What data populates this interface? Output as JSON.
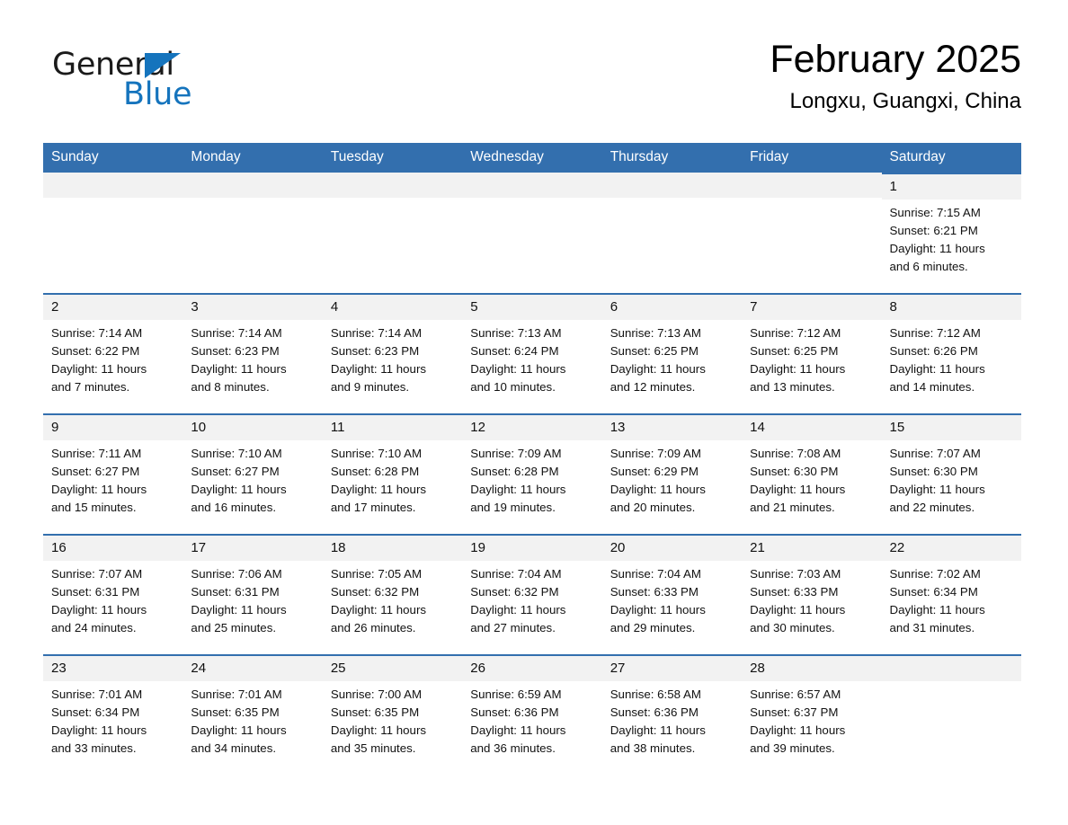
{
  "brand": {
    "word_one": "General",
    "word_two": "Blue",
    "triangle_icon": "triangle-icon",
    "accent_color": "#1574bd"
  },
  "header": {
    "month_title": "February 2025",
    "location": "Longxu, Guangxi, China",
    "header_bg_color": "#336fae",
    "daynum_bg_color": "#f2f2f2"
  },
  "weekday_headers": [
    "Sunday",
    "Monday",
    "Tuesday",
    "Wednesday",
    "Thursday",
    "Friday",
    "Saturday"
  ],
  "labels": {
    "sunrise_prefix": "Sunrise:",
    "sunset_prefix": "Sunset:",
    "daylight_prefix": "Daylight:"
  },
  "weeks": [
    [
      {
        "day": "",
        "sunrise": "",
        "sunset": "",
        "daylight_line1": "",
        "daylight_line2": "",
        "empty": true
      },
      {
        "day": "",
        "sunrise": "",
        "sunset": "",
        "daylight_line1": "",
        "daylight_line2": "",
        "empty": true
      },
      {
        "day": "",
        "sunrise": "",
        "sunset": "",
        "daylight_line1": "",
        "daylight_line2": "",
        "empty": true
      },
      {
        "day": "",
        "sunrise": "",
        "sunset": "",
        "daylight_line1": "",
        "daylight_line2": "",
        "empty": true
      },
      {
        "day": "",
        "sunrise": "",
        "sunset": "",
        "daylight_line1": "",
        "daylight_line2": "",
        "empty": true
      },
      {
        "day": "",
        "sunrise": "",
        "sunset": "",
        "daylight_line1": "",
        "daylight_line2": "",
        "empty": true
      },
      {
        "day": "1",
        "sunrise": "Sunrise: 7:15 AM",
        "sunset": "Sunset: 6:21 PM",
        "daylight_line1": "Daylight: 11 hours",
        "daylight_line2": "and 6 minutes.",
        "empty": false
      }
    ],
    [
      {
        "day": "2",
        "sunrise": "Sunrise: 7:14 AM",
        "sunset": "Sunset: 6:22 PM",
        "daylight_line1": "Daylight: 11 hours",
        "daylight_line2": "and 7 minutes.",
        "empty": false
      },
      {
        "day": "3",
        "sunrise": "Sunrise: 7:14 AM",
        "sunset": "Sunset: 6:23 PM",
        "daylight_line1": "Daylight: 11 hours",
        "daylight_line2": "and 8 minutes.",
        "empty": false
      },
      {
        "day": "4",
        "sunrise": "Sunrise: 7:14 AM",
        "sunset": "Sunset: 6:23 PM",
        "daylight_line1": "Daylight: 11 hours",
        "daylight_line2": "and 9 minutes.",
        "empty": false
      },
      {
        "day": "5",
        "sunrise": "Sunrise: 7:13 AM",
        "sunset": "Sunset: 6:24 PM",
        "daylight_line1": "Daylight: 11 hours",
        "daylight_line2": "and 10 minutes.",
        "empty": false
      },
      {
        "day": "6",
        "sunrise": "Sunrise: 7:13 AM",
        "sunset": "Sunset: 6:25 PM",
        "daylight_line1": "Daylight: 11 hours",
        "daylight_line2": "and 12 minutes.",
        "empty": false
      },
      {
        "day": "7",
        "sunrise": "Sunrise: 7:12 AM",
        "sunset": "Sunset: 6:25 PM",
        "daylight_line1": "Daylight: 11 hours",
        "daylight_line2": "and 13 minutes.",
        "empty": false
      },
      {
        "day": "8",
        "sunrise": "Sunrise: 7:12 AM",
        "sunset": "Sunset: 6:26 PM",
        "daylight_line1": "Daylight: 11 hours",
        "daylight_line2": "and 14 minutes.",
        "empty": false
      }
    ],
    [
      {
        "day": "9",
        "sunrise": "Sunrise: 7:11 AM",
        "sunset": "Sunset: 6:27 PM",
        "daylight_line1": "Daylight: 11 hours",
        "daylight_line2": "and 15 minutes.",
        "empty": false
      },
      {
        "day": "10",
        "sunrise": "Sunrise: 7:10 AM",
        "sunset": "Sunset: 6:27 PM",
        "daylight_line1": "Daylight: 11 hours",
        "daylight_line2": "and 16 minutes.",
        "empty": false
      },
      {
        "day": "11",
        "sunrise": "Sunrise: 7:10 AM",
        "sunset": "Sunset: 6:28 PM",
        "daylight_line1": "Daylight: 11 hours",
        "daylight_line2": "and 17 minutes.",
        "empty": false
      },
      {
        "day": "12",
        "sunrise": "Sunrise: 7:09 AM",
        "sunset": "Sunset: 6:28 PM",
        "daylight_line1": "Daylight: 11 hours",
        "daylight_line2": "and 19 minutes.",
        "empty": false
      },
      {
        "day": "13",
        "sunrise": "Sunrise: 7:09 AM",
        "sunset": "Sunset: 6:29 PM",
        "daylight_line1": "Daylight: 11 hours",
        "daylight_line2": "and 20 minutes.",
        "empty": false
      },
      {
        "day": "14",
        "sunrise": "Sunrise: 7:08 AM",
        "sunset": "Sunset: 6:30 PM",
        "daylight_line1": "Daylight: 11 hours",
        "daylight_line2": "and 21 minutes.",
        "empty": false
      },
      {
        "day": "15",
        "sunrise": "Sunrise: 7:07 AM",
        "sunset": "Sunset: 6:30 PM",
        "daylight_line1": "Daylight: 11 hours",
        "daylight_line2": "and 22 minutes.",
        "empty": false
      }
    ],
    [
      {
        "day": "16",
        "sunrise": "Sunrise: 7:07 AM",
        "sunset": "Sunset: 6:31 PM",
        "daylight_line1": "Daylight: 11 hours",
        "daylight_line2": "and 24 minutes.",
        "empty": false
      },
      {
        "day": "17",
        "sunrise": "Sunrise: 7:06 AM",
        "sunset": "Sunset: 6:31 PM",
        "daylight_line1": "Daylight: 11 hours",
        "daylight_line2": "and 25 minutes.",
        "empty": false
      },
      {
        "day": "18",
        "sunrise": "Sunrise: 7:05 AM",
        "sunset": "Sunset: 6:32 PM",
        "daylight_line1": "Daylight: 11 hours",
        "daylight_line2": "and 26 minutes.",
        "empty": false
      },
      {
        "day": "19",
        "sunrise": "Sunrise: 7:04 AM",
        "sunset": "Sunset: 6:32 PM",
        "daylight_line1": "Daylight: 11 hours",
        "daylight_line2": "and 27 minutes.",
        "empty": false
      },
      {
        "day": "20",
        "sunrise": "Sunrise: 7:04 AM",
        "sunset": "Sunset: 6:33 PM",
        "daylight_line1": "Daylight: 11 hours",
        "daylight_line2": "and 29 minutes.",
        "empty": false
      },
      {
        "day": "21",
        "sunrise": "Sunrise: 7:03 AM",
        "sunset": "Sunset: 6:33 PM",
        "daylight_line1": "Daylight: 11 hours",
        "daylight_line2": "and 30 minutes.",
        "empty": false
      },
      {
        "day": "22",
        "sunrise": "Sunrise: 7:02 AM",
        "sunset": "Sunset: 6:34 PM",
        "daylight_line1": "Daylight: 11 hours",
        "daylight_line2": "and 31 minutes.",
        "empty": false
      }
    ],
    [
      {
        "day": "23",
        "sunrise": "Sunrise: 7:01 AM",
        "sunset": "Sunset: 6:34 PM",
        "daylight_line1": "Daylight: 11 hours",
        "daylight_line2": "and 33 minutes.",
        "empty": false
      },
      {
        "day": "24",
        "sunrise": "Sunrise: 7:01 AM",
        "sunset": "Sunset: 6:35 PM",
        "daylight_line1": "Daylight: 11 hours",
        "daylight_line2": "and 34 minutes.",
        "empty": false
      },
      {
        "day": "25",
        "sunrise": "Sunrise: 7:00 AM",
        "sunset": "Sunset: 6:35 PM",
        "daylight_line1": "Daylight: 11 hours",
        "daylight_line2": "and 35 minutes.",
        "empty": false
      },
      {
        "day": "26",
        "sunrise": "Sunrise: 6:59 AM",
        "sunset": "Sunset: 6:36 PM",
        "daylight_line1": "Daylight: 11 hours",
        "daylight_line2": "and 36 minutes.",
        "empty": false
      },
      {
        "day": "27",
        "sunrise": "Sunrise: 6:58 AM",
        "sunset": "Sunset: 6:36 PM",
        "daylight_line1": "Daylight: 11 hours",
        "daylight_line2": "and 38 minutes.",
        "empty": false
      },
      {
        "day": "28",
        "sunrise": "Sunrise: 6:57 AM",
        "sunset": "Sunset: 6:37 PM",
        "daylight_line1": "Daylight: 11 hours",
        "daylight_line2": "and 39 minutes.",
        "empty": false
      },
      {
        "day": "",
        "sunrise": "",
        "sunset": "",
        "daylight_line1": "",
        "daylight_line2": "",
        "empty": true
      }
    ]
  ]
}
